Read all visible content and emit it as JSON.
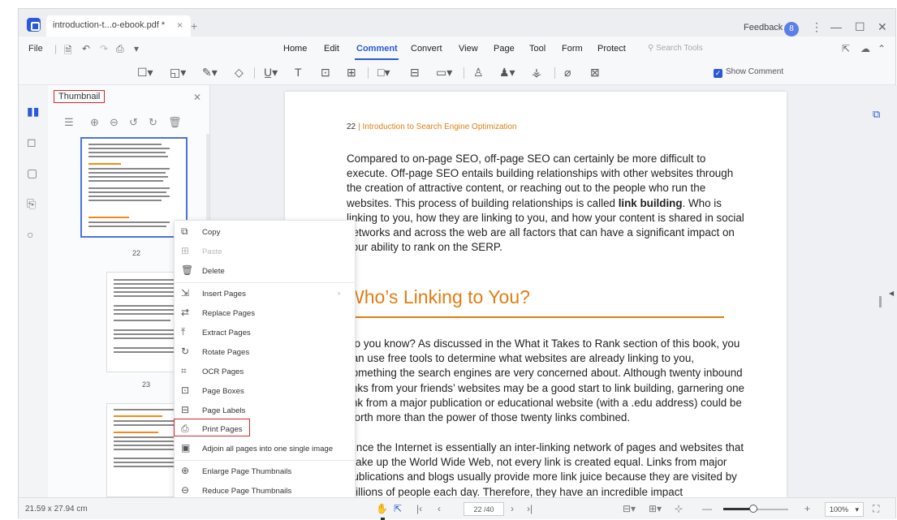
{
  "titlebar": {
    "tab_title": "introduction-t...o-ebook.pdf *",
    "tab_close": "×",
    "tab_add": "+",
    "feedback": "Feedback",
    "avatar_initial": "8",
    "more": "⋮",
    "minimize": "—",
    "maximize": "☐",
    "close": "✕"
  },
  "menubar": {
    "file": "File",
    "items": [
      "Home",
      "Edit",
      "Comment",
      "Convert",
      "View",
      "Page",
      "Tool",
      "Form",
      "Protect"
    ],
    "active": "Comment",
    "search_placeholder": "Search Tools"
  },
  "toolbar": {
    "show_comment_label": "Show Comment",
    "show_comment_checked": true
  },
  "thumbnail_panel": {
    "title": "Thumbnail",
    "pages": [
      "22",
      "23"
    ]
  },
  "context_menu": {
    "items": [
      {
        "label": "Copy",
        "icon": "copy-icon",
        "enabled": true
      },
      {
        "label": "Paste",
        "icon": "paste-icon",
        "enabled": false
      },
      {
        "label": "Delete",
        "icon": "delete-icon",
        "enabled": true
      },
      {
        "label": "Insert Pages",
        "icon": "insert-pages-icon",
        "enabled": true,
        "submenu": true
      },
      {
        "label": "Replace Pages",
        "icon": "replace-pages-icon",
        "enabled": true
      },
      {
        "label": "Extract Pages",
        "icon": "extract-pages-icon",
        "enabled": true
      },
      {
        "label": "Rotate Pages",
        "icon": "rotate-pages-icon",
        "enabled": true
      },
      {
        "label": "OCR Pages",
        "icon": "ocr-pages-icon",
        "enabled": true
      },
      {
        "label": "Page Boxes",
        "icon": "page-boxes-icon",
        "enabled": true
      },
      {
        "label": "Page Labels",
        "icon": "page-labels-icon",
        "enabled": true
      },
      {
        "label": "Print Pages",
        "icon": "print-pages-icon",
        "enabled": true,
        "highlighted": true
      },
      {
        "label": "Adjoin all pages into one single image",
        "icon": "adjoin-icon",
        "enabled": true
      },
      {
        "label": "Enlarge Page Thumbnails",
        "icon": "enlarge-icon",
        "enabled": true
      },
      {
        "label": "Reduce Page Thumbnails",
        "icon": "reduce-icon",
        "enabled": true
      }
    ]
  },
  "document": {
    "header_page": "22",
    "header_title": "Introduction to Search Engine Optimization",
    "para1_a": "Compared to on-page SEO, off-page SEO can certainly be more difficult to execute. Off-page SEO entails building relationships with other websites through the creation of attractive content, or reaching out to the people who run the websites. This process of building relationships is called ",
    "para1_bold": "link building",
    "para1_b": ". Who is linking to you, how they are linking to you, and how your content is shared in social networks and across the web are all factors that can have a significant impact on your ability to rank on the SERP.",
    "heading": "Who’s Linking to You?",
    "para2": "Do you know? As discussed in the What it Takes to Rank section of this book, you can use free tools to determine what websites are already linking to you, something the search engines are very concerned about. Although twenty inbound links from your friends’ websites may be a good start to link building, garnering one link from a major publication or educational website (with a .edu address) could be worth more than the power of those twenty links combined.",
    "para3": "Since the Internet is essentially an inter-linking network of pages and websites that make up the World Wide Web, not every link is created equal. Links from major publications and blogs usually provide more link juice because they are visited by millions of people each day. Therefore, they have an incredible impact"
  },
  "statusbar": {
    "dimensions": "21.59 x 27.94 cm",
    "page_indicator": "22 /40",
    "zoom": "100%",
    "zoom_fraction": 0.45
  },
  "colors": {
    "accent": "#2a5ad8",
    "orange": "#e07e12",
    "highlight_red": "#d9262b"
  }
}
